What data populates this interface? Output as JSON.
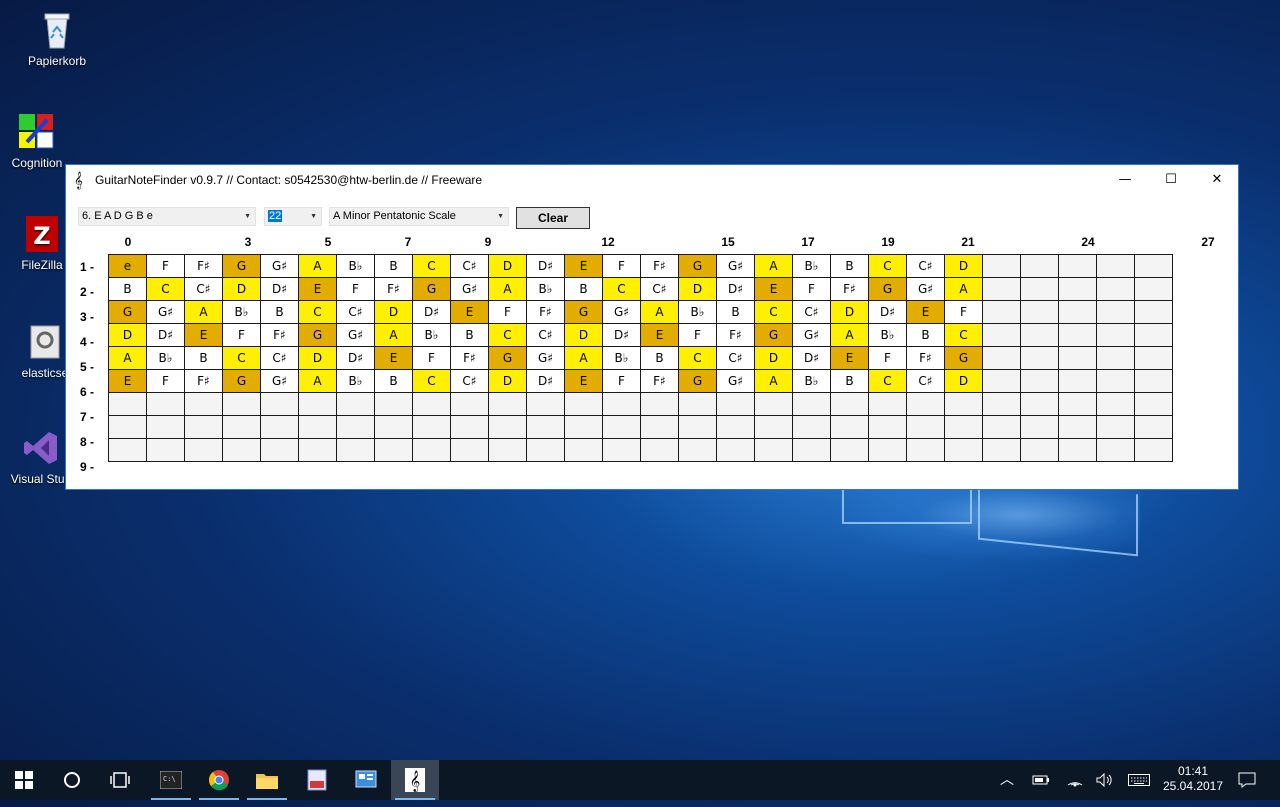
{
  "desktop": {
    "icons": [
      {
        "label": "Papierkorb"
      },
      {
        "label": "Cognition"
      },
      {
        "label": "FileZilla"
      },
      {
        "label": "elasticse"
      },
      {
        "label": "Visual Stud"
      }
    ]
  },
  "window": {
    "title": "GuitarNoteFinder v0.9.7 // Contact: s0542530@htw-berlin.de // Freeware",
    "title_icon": "𝄞",
    "controls": {
      "minimize": "—",
      "maximize": "☐",
      "close": "✕"
    }
  },
  "toolbar": {
    "tuning_value": "6. E A D G B e",
    "frets_value": "22",
    "scale_value": "A Minor Pentatonic Scale",
    "clear_label": "Clear"
  },
  "fretboard": {
    "fret_markers": [
      {
        "col": 0,
        "label": "0"
      },
      {
        "col": 3,
        "label": "3"
      },
      {
        "col": 5,
        "label": "5"
      },
      {
        "col": 7,
        "label": "7"
      },
      {
        "col": 9,
        "label": "9"
      },
      {
        "col": 12,
        "label": "12"
      },
      {
        "col": 15,
        "label": "15"
      },
      {
        "col": 17,
        "label": "17"
      },
      {
        "col": 19,
        "label": "19"
      },
      {
        "col": 21,
        "label": "21"
      },
      {
        "col": 24,
        "label": "24"
      },
      {
        "col": 27,
        "label": "27"
      }
    ],
    "string_labels": [
      "1 -",
      "2 -",
      "3 -",
      "4 -",
      "5 -",
      "6 -",
      "7 -",
      "8 -",
      "9 -"
    ],
    "rows": [
      {
        "notes": [
          "e",
          "F",
          "F♯",
          "G",
          "G♯",
          "A",
          "B♭",
          "B",
          "C",
          "C♯",
          "D",
          "D♯",
          "E",
          "F",
          "F♯",
          "G",
          "G♯",
          "A",
          "B♭",
          "B",
          "C",
          "C♯",
          "D"
        ],
        "types": "owwowywwywyworwwowywwywy"
      },
      {
        "notes": [
          "B",
          "C",
          "C♯",
          "D",
          "D♯",
          "E",
          "F",
          "F♯",
          "G",
          "G♯",
          "A",
          "B♭",
          "B",
          "C",
          "C♯",
          "D",
          "D♯",
          "E",
          "F",
          "F♯",
          "G",
          "G♯",
          "A"
        ],
        "types": "wywywowwowywwywywowwowy"
      },
      {
        "notes": [
          "G",
          "G♯",
          "A",
          "B♭",
          "B",
          "C",
          "C♯",
          "D",
          "D♯",
          "E",
          "F",
          "F♯",
          "G",
          "G♯",
          "A",
          "B♭",
          "B",
          "C",
          "C♯",
          "D",
          "D♯",
          "E",
          "F"
        ],
        "types": "owywwywywowwowywwywywow"
      },
      {
        "notes": [
          "D",
          "D♯",
          "E",
          "F",
          "F♯",
          "G",
          "G♯",
          "A",
          "B♭",
          "B",
          "C",
          "C♯",
          "D",
          "D♯",
          "E",
          "F",
          "F♯",
          "G",
          "G♯",
          "A",
          "B♭",
          "B",
          "C"
        ],
        "types": "ywowwowywwywywowwowywwy"
      },
      {
        "notes": [
          "A",
          "B♭",
          "B",
          "C",
          "C♯",
          "D",
          "D♯",
          "E",
          "F",
          "F♯",
          "G",
          "G♯",
          "A",
          "B♭",
          "B",
          "C",
          "C♯",
          "D",
          "D♯",
          "E",
          "F",
          "F♯",
          "G"
        ],
        "types": "ywwywywowwowywwywywowwo"
      },
      {
        "notes": [
          "E",
          "F",
          "F♯",
          "G",
          "G♯",
          "A",
          "B♭",
          "B",
          "C",
          "C♯",
          "D",
          "D♯",
          "E",
          "F",
          "F♯",
          "G",
          "G♯",
          "A",
          "B♭",
          "B",
          "C",
          "C♯",
          "D"
        ],
        "types": "owwowywwywyworwwowywwywy"
      },
      {
        "notes": [],
        "types": ""
      },
      {
        "notes": [],
        "types": ""
      },
      {
        "notes": [],
        "types": ""
      }
    ],
    "columns": 28,
    "colors": {
      "root": "#e3ad00",
      "scale": "#ffef00",
      "other": "#ffffff",
      "empty": "#f4f4f4"
    }
  },
  "taskbar": {
    "apps": [
      {
        "name": "start",
        "icon": "windows-logo"
      },
      {
        "name": "cortana",
        "icon": "search-circle"
      },
      {
        "name": "task-view",
        "icon": "task-view"
      },
      {
        "name": "cmd",
        "icon": "terminal"
      },
      {
        "name": "chrome",
        "icon": "chrome"
      },
      {
        "name": "explorer",
        "icon": "folder"
      },
      {
        "name": "pdf",
        "icon": "pdf"
      },
      {
        "name": "control",
        "icon": "control-panel"
      },
      {
        "name": "guitarnotefinder",
        "icon": "treble-clef"
      }
    ],
    "clock_time": "01:41",
    "clock_date": "25.04.2017"
  }
}
